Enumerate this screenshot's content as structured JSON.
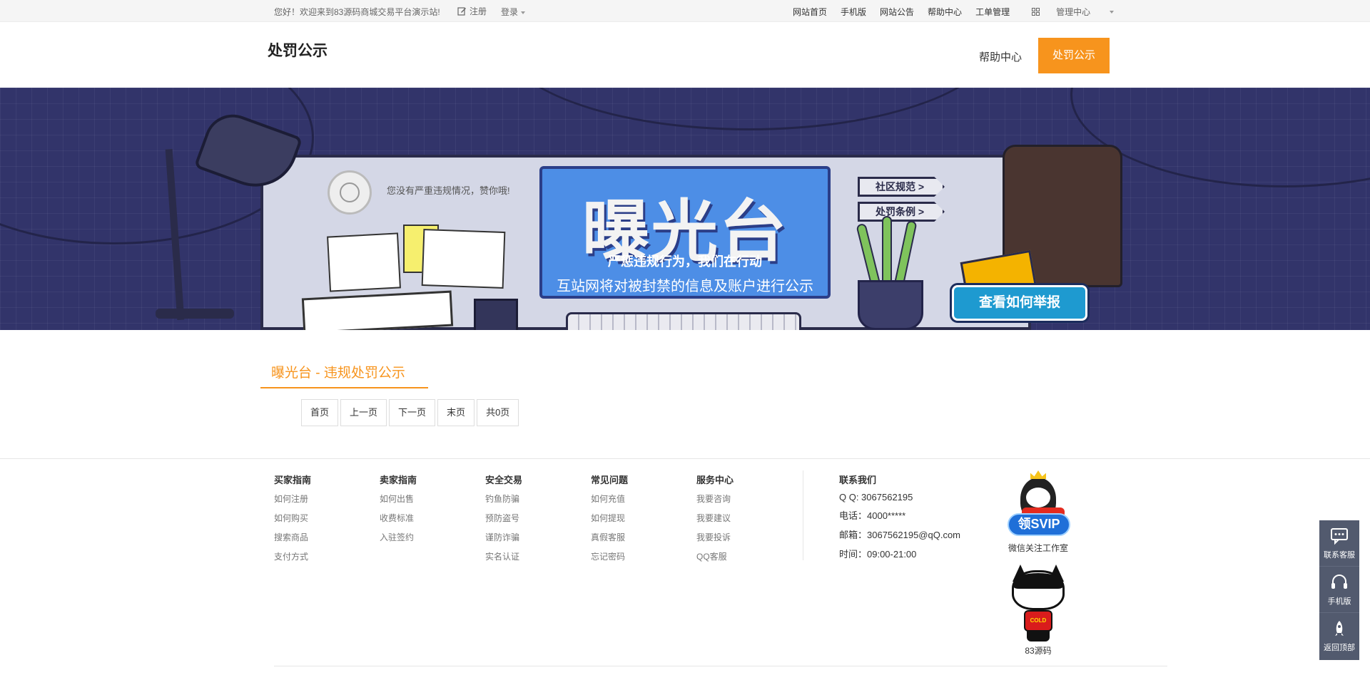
{
  "topbar": {
    "welcome": "您好！欢迎来到83源码商城交易平台演示站!",
    "register": "注册",
    "login": "登录",
    "nav": [
      "网站首页",
      "手机版",
      "网站公告",
      "帮助中心",
      "工单管理"
    ],
    "admin": "管理中心"
  },
  "header": {
    "title": "处罚公示",
    "help_link": "帮助中心",
    "active_link": "处罚公示"
  },
  "banner": {
    "notice": "您没有严重违规情况，赞你哦!",
    "tv_title": "曝光台",
    "tv_slogan": "严惩违规行为，我们在行动",
    "tv_desc": "互站网将对被封禁的信息及账户进行公示",
    "sign_1": "社区规范 >",
    "sign_2": "处罚条例 >",
    "report_button": "查看如何举报"
  },
  "content": {
    "section_title": "曝光台 - 违规处罚公示",
    "pager": [
      "首页",
      "上一页",
      "下一页",
      "末页",
      "共0页"
    ]
  },
  "footer": {
    "columns": [
      {
        "title": "买家指南",
        "links": [
          "如何注册",
          "如何购买",
          "搜索商品",
          "支付方式"
        ]
      },
      {
        "title": "卖家指南",
        "links": [
          "如何出售",
          "收费标准",
          "入驻签约"
        ]
      },
      {
        "title": "安全交易",
        "links": [
          "钓鱼防骗",
          "预防盗号",
          "谨防诈骗",
          "实名认证"
        ]
      },
      {
        "title": "常见问题",
        "links": [
          "如何充值",
          "如何提现",
          "真假客服",
          "忘记密码"
        ]
      },
      {
        "title": "服务中心",
        "links": [
          "我要咨询",
          "我要建议",
          "我要投诉",
          "QQ客服"
        ]
      }
    ],
    "contact": {
      "title": "联系我们",
      "qq": "Q Q: 3067562195",
      "phone": "电话：4000*****",
      "email": "邮箱：3067562195@qQ.com",
      "hours": "时间：09:00-21:00"
    },
    "qr1_label": "微信关注工作室",
    "qr1_badge": "领SVIP",
    "qr2_label": "83源码",
    "qr2_shirt": "COLD"
  },
  "dock": {
    "items": [
      {
        "label": "联系客服",
        "icon": "chat-icon"
      },
      {
        "label": "手机版",
        "icon": "headset-icon"
      },
      {
        "label": "返回顶部",
        "icon": "rocket-icon"
      }
    ]
  },
  "colors": {
    "accent": "#f7941d",
    "banner_bg": "#32346a",
    "dock_bg": "#525a6e"
  }
}
